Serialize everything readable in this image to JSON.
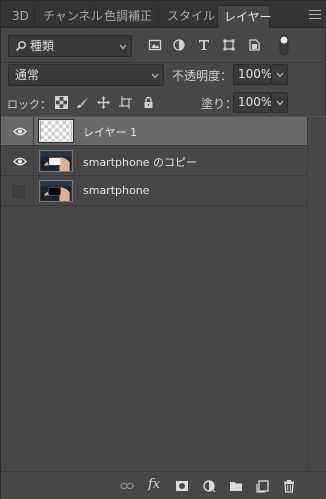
{
  "tabs": [
    {
      "label": "3D"
    },
    {
      "label": "チャンネル"
    },
    {
      "label": "色調補正"
    },
    {
      "label": "スタイル"
    },
    {
      "label": "レイヤー"
    }
  ],
  "filter": {
    "kind_label": "種類",
    "icons": [
      "image-filter-icon",
      "adjustment-filter-icon",
      "type-filter-icon",
      "shape-filter-icon",
      "smart-object-filter-icon",
      "filter-toggle-icon"
    ]
  },
  "blend": {
    "mode": "通常",
    "opacity_label": "不透明度：",
    "opacity_value": "100%"
  },
  "lock": {
    "label": "ロック：",
    "fill_label": "塗り：",
    "fill_value": "100%",
    "icons": [
      "lock-transparent-pixels-icon",
      "lock-image-pixels-icon",
      "lock-position-icon",
      "lock-artboard-icon",
      "lock-all-icon"
    ]
  },
  "layers": [
    {
      "name": "レイヤー 1",
      "visible": true,
      "selected": true,
      "thumb": "transparent"
    },
    {
      "name": "smartphone のコピー",
      "visible": true,
      "selected": false,
      "thumb": "hand-phone-white"
    },
    {
      "name": "smartphone",
      "visible": false,
      "selected": false,
      "thumb": "hand-phone-black"
    }
  ],
  "bottom_icons": [
    "link-layers-icon",
    "fx-icon",
    "add-mask-icon",
    "adjustment-layer-icon",
    "new-group-icon",
    "new-layer-icon",
    "delete-layer-icon"
  ],
  "bottom_fx_label": "fx",
  "colors": {
    "panel_bg": "#474747",
    "tab_bg": "#343434",
    "selected_row": "#696969"
  }
}
